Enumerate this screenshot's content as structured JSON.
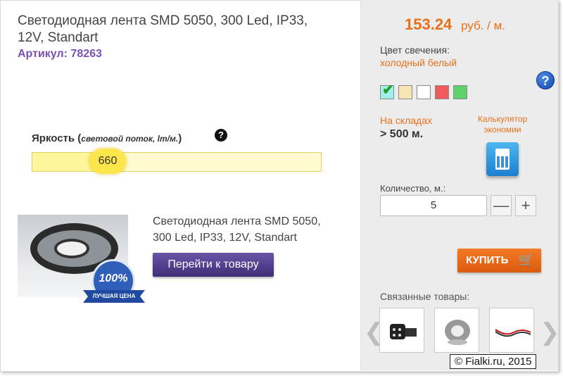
{
  "product": {
    "title_line1": "Светодиодная лента SMD 5050, 300 Led, IP33,",
    "title_line2": "12V, Standart",
    "article": "Артикул: 78263"
  },
  "brightness": {
    "label": "Яркость (",
    "label_unit": "световой поток, lm/м.",
    "label_close": ")",
    "help": "?",
    "value": "660",
    "level_fraction": 0.32
  },
  "promo": {
    "line1": "Светодиодная лента SMD 5050,",
    "line2": "300 Led, IP33, 12V, Standart",
    "button": "Перейти к товару",
    "seal_percent": "100%",
    "seal_text": "ЛУЧШАЯ ЦЕНА"
  },
  "purchase": {
    "price": "153.24",
    "price_unit": "руб. / м.",
    "color_label": "Цвет свечения:",
    "color_value": "холодный белый",
    "help": "?",
    "swatches": [
      {
        "name": "cold-white",
        "color": "#a0f0ee",
        "selected": true
      },
      {
        "name": "warm-white",
        "color": "#f7e6b5",
        "selected": false
      },
      {
        "name": "white",
        "color": "#ffffff",
        "selected": false
      },
      {
        "name": "red",
        "color": "#f2595c",
        "selected": false
      },
      {
        "name": "green",
        "color": "#5ed36a",
        "selected": false
      }
    ],
    "stock_label": "На складах",
    "stock_value": "> 500 м.",
    "calc_label_line1": "Калькулятор",
    "calc_label_line2": "экономии",
    "qty_label": "Количество, м.:",
    "qty_value": "5",
    "minus": "—",
    "plus": "+",
    "buy_label": "КУПИТЬ",
    "related_label": "Связанные товары:",
    "arrow_left": "❮",
    "arrow_right": "❯"
  },
  "watermark": "© Fialki.ru, 2015",
  "icons": {
    "check": "check-icon",
    "cart": "cart-icon",
    "calculator": "calculator-icon",
    "help": "question-icon"
  },
  "colors": {
    "accent_orange": "#e8701a",
    "article_purple": "#7b4fb3",
    "button_purple": "#4a3988"
  }
}
